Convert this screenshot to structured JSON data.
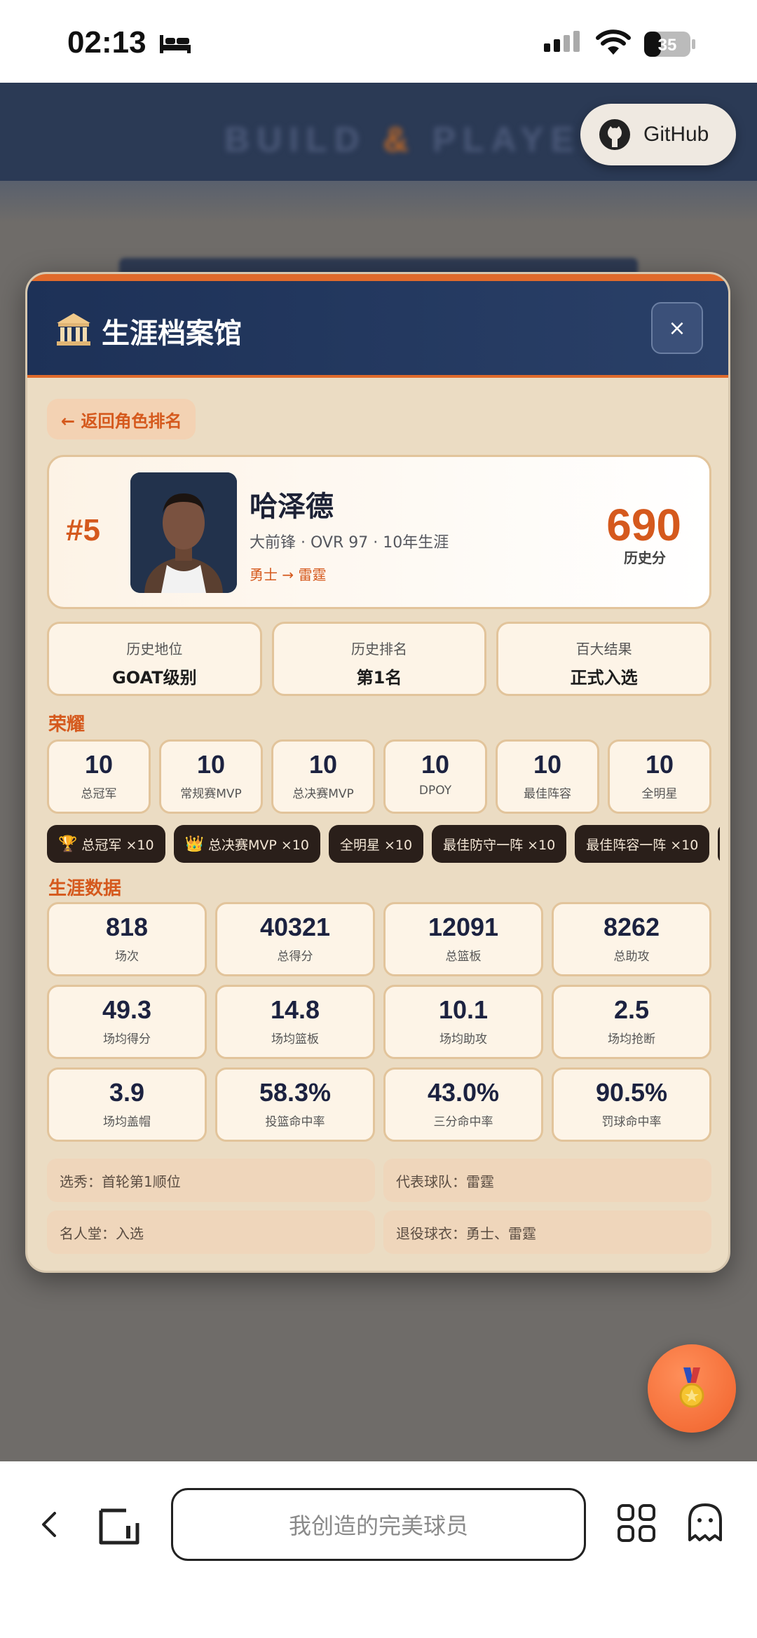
{
  "status": {
    "time": "02:13",
    "battery": "35"
  },
  "background": {
    "title_left": "BUILD",
    "title_amp": "&",
    "title_right": "PLAYER",
    "github_label": "GitHub"
  },
  "modal": {
    "icon": "museum-icon",
    "title": "生涯档案馆",
    "close_label": "×",
    "back_label": "← 返回角色排名"
  },
  "player": {
    "rank": "#5",
    "name": "哈泽德",
    "meta": "大前锋 · OVR 97 · 10年生涯",
    "teams": "勇士 → 雷霆",
    "score": "690",
    "score_label": "历史分"
  },
  "summary": [
    {
      "label": "历史地位",
      "value": "GOAT级别"
    },
    {
      "label": "历史排名",
      "value": "第1名"
    },
    {
      "label": "百大结果",
      "value": "正式入选"
    }
  ],
  "honors_title": "荣耀",
  "honors": [
    {
      "value": "10",
      "label": "总冠军"
    },
    {
      "value": "10",
      "label": "常规赛MVP"
    },
    {
      "value": "10",
      "label": "总决赛MVP"
    },
    {
      "value": "10",
      "label": "DPOY"
    },
    {
      "value": "10",
      "label": "最佳阵容"
    },
    {
      "value": "10",
      "label": "全明星"
    }
  ],
  "badges": [
    {
      "icon": "🏆",
      "text": "总冠军 ×10"
    },
    {
      "icon": "👑",
      "text": "总决赛MVP ×10"
    },
    {
      "icon": "",
      "text": "全明星 ×10"
    },
    {
      "icon": "",
      "text": "最佳防守一阵 ×10"
    },
    {
      "icon": "",
      "text": "最佳阵容一阵 ×10"
    },
    {
      "icon": "",
      "text": ""
    }
  ],
  "career_title": "生涯数据",
  "stats": [
    {
      "value": "818",
      "label": "场次"
    },
    {
      "value": "40321",
      "label": "总得分"
    },
    {
      "value": "12091",
      "label": "总篮板"
    },
    {
      "value": "8262",
      "label": "总助攻"
    },
    {
      "value": "49.3",
      "label": "场均得分"
    },
    {
      "value": "14.8",
      "label": "场均篮板"
    },
    {
      "value": "10.1",
      "label": "场均助攻"
    },
    {
      "value": "2.5",
      "label": "场均抢断"
    },
    {
      "value": "3.9",
      "label": "场均盖帽"
    },
    {
      "value": "58.3%",
      "label": "投篮命中率"
    },
    {
      "value": "43.0%",
      "label": "三分命中率"
    },
    {
      "value": "90.5%",
      "label": "罚球命中率"
    }
  ],
  "facts": [
    "选秀：首轮第1顺位",
    "代表球队：雷霆",
    "名人堂：入选",
    "退役球衣：勇士、雷霆"
  ],
  "fab_icon": "medal-icon",
  "browser": {
    "url_text": "我创造的完美球员"
  },
  "colors": {
    "accent": "#d5591d",
    "header": "#1d3157",
    "panel": "#ebdcc3"
  }
}
